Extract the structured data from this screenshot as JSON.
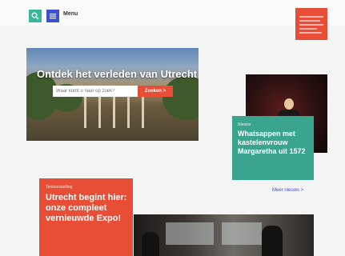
{
  "header": {
    "menu_label": "Menu",
    "search_icon": "search-icon",
    "menu_icon": "hamburger-icon",
    "colors": {
      "search": "#39b79b",
      "menu": "#3e4fcf",
      "logo": "#e84d36"
    }
  },
  "hero": {
    "title": "Ontdek het verleden van Utrecht",
    "search_placeholder": "Waar komt u naar op zoek?",
    "search_button": "Zoeken >"
  },
  "feature_right": {
    "tag": "Nieuws",
    "title": "Whatsappen met kastelenvrouw Margaretha uit 1572",
    "color": "#3aa48f"
  },
  "more_link": "Meer nieuws >",
  "feature_left": {
    "tag": "Tentoonstelling",
    "title": "Utrecht begint hier: onze compleet vernieuwde Expo!",
    "color": "#e84d36"
  }
}
